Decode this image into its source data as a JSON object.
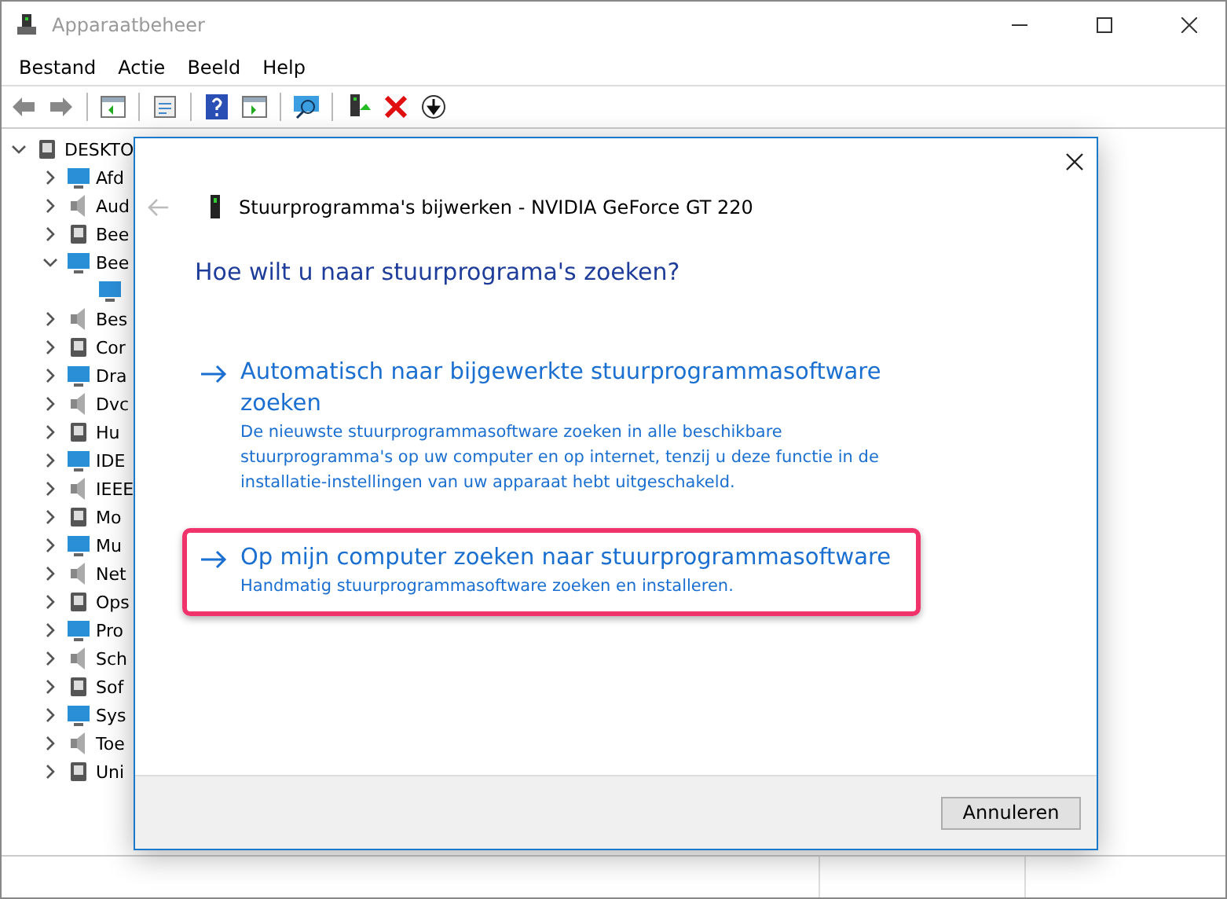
{
  "window": {
    "title": "Apparaatbeheer"
  },
  "menu": [
    "Bestand",
    "Actie",
    "Beeld",
    "Help"
  ],
  "tree": {
    "label": "DESKTO",
    "expanded": true,
    "children": [
      {
        "label": "Afd",
        "expanded": false
      },
      {
        "label": "Aud",
        "expanded": false
      },
      {
        "label": "Bee",
        "expanded": false
      },
      {
        "label": "Bee",
        "expanded": true,
        "children": [
          {
            "kind": "leaf"
          }
        ]
      },
      {
        "label": "Bes",
        "expanded": false
      },
      {
        "label": "Cor",
        "expanded": false
      },
      {
        "label": "Dra",
        "expanded": false
      },
      {
        "label": "Dvc",
        "expanded": false
      },
      {
        "label": "Hu",
        "expanded": false
      },
      {
        "label": "IDE",
        "expanded": false
      },
      {
        "label": "IEEE",
        "expanded": false
      },
      {
        "label": "Mo",
        "expanded": false
      },
      {
        "label": "Mu",
        "expanded": false
      },
      {
        "label": "Net",
        "expanded": false
      },
      {
        "label": "Ops",
        "expanded": false
      },
      {
        "label": "Pro",
        "expanded": false
      },
      {
        "label": "Sch",
        "expanded": false
      },
      {
        "label": "Sof",
        "expanded": false
      },
      {
        "label": "Sys",
        "expanded": false
      },
      {
        "label": "Toe",
        "expanded": false
      },
      {
        "label": "Uni",
        "expanded": false
      }
    ]
  },
  "dialog": {
    "title": "Stuurprogramma's bijwerken - NVIDIA GeForce GT 220",
    "heading": "Hoe wilt u naar stuurprograma's zoeken?",
    "options": [
      {
        "title": "Automatisch naar bijgewerkte stuurprogrammasoftware zoeken",
        "description": "De nieuwste stuurprogrammasoftware zoeken in alle beschikbare stuurprogramma's op uw computer en op internet, tenzij u deze functie in de installatie-instellingen van uw apparaat hebt uitgeschakeld.",
        "highlighted": false
      },
      {
        "title": "Op mijn computer zoeken naar stuurprogrammasoftware",
        "description": "Handmatig stuurprogrammasoftware zoeken en installeren.",
        "highlighted": true
      }
    ],
    "cancel": "Annuleren"
  }
}
